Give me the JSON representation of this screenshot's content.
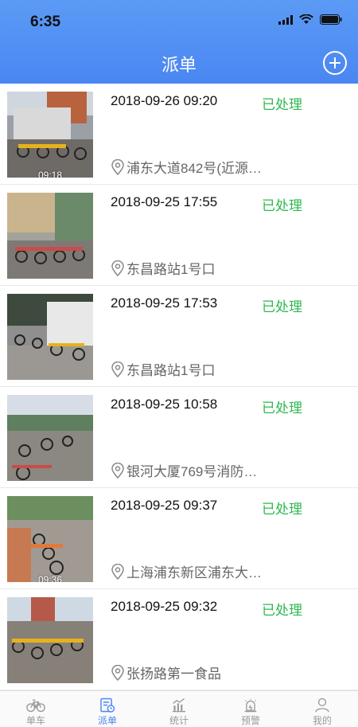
{
  "status_bar": {
    "time": "6:35"
  },
  "header": {
    "title": "派单",
    "add_icon": "plus-circle-icon"
  },
  "colors": {
    "header": "#4a86f2",
    "status_done": "#2cb84e",
    "accent": "#4a86f2"
  },
  "orders": [
    {
      "datetime": "2018-09-26 09:20",
      "status": "已处理",
      "location": "浦东大道842号(近源…",
      "thumb_time": "09:18"
    },
    {
      "datetime": "2018-09-25 17:55",
      "status": "已处理",
      "location": "东昌路站1号口",
      "thumb_time": ""
    },
    {
      "datetime": "2018-09-25 17:53",
      "status": "已处理",
      "location": "东昌路站1号口",
      "thumb_time": ""
    },
    {
      "datetime": "2018-09-25 10:58",
      "status": "已处理",
      "location": "银河大厦769号消防…",
      "thumb_time": ""
    },
    {
      "datetime": "2018-09-25 09:37",
      "status": "已处理",
      "location": "上海浦东新区浦东大…",
      "thumb_time": "09:36"
    },
    {
      "datetime": "2018-09-25 09:32",
      "status": "已处理",
      "location": "张扬路第一食品",
      "thumb_time": ""
    }
  ],
  "tabbar": {
    "tabs": [
      {
        "label": "单车",
        "icon": "bicycle-icon"
      },
      {
        "label": "派单",
        "icon": "dispatch-icon"
      },
      {
        "label": "统计",
        "icon": "chart-icon"
      },
      {
        "label": "预警",
        "icon": "alert-icon"
      },
      {
        "label": "我的",
        "icon": "user-icon"
      }
    ],
    "active_index": 1
  }
}
